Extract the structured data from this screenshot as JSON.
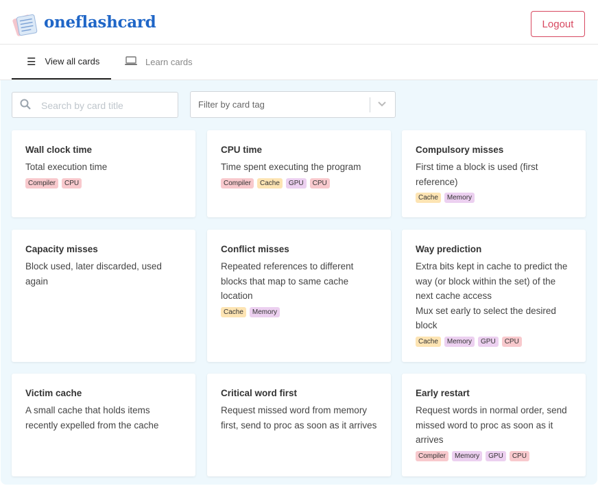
{
  "app": {
    "brand": "oneflashcard",
    "logout_label": "Logout"
  },
  "tabs": [
    {
      "label": "View all cards",
      "icon": "menu-icon",
      "active": true
    },
    {
      "label": "Learn cards",
      "icon": "laptop-icon",
      "active": false
    }
  ],
  "search": {
    "placeholder": "Search by card title",
    "value": ""
  },
  "filter": {
    "placeholder": "Filter by card tag"
  },
  "tag_colors": {
    "Compiler": "#f8c9cd",
    "CPU": "#f8c9cd",
    "Cache": "#fde4b3",
    "GPU": "#ecd0f0",
    "Memory": "#ecd0f0"
  },
  "cards": [
    {
      "title": "Wall clock time",
      "lines": [
        "Total execution time"
      ],
      "tags": [
        "Compiler",
        "CPU"
      ]
    },
    {
      "title": "CPU time",
      "lines": [
        "Time spent executing the program"
      ],
      "tags": [
        "Compiler",
        "Cache",
        "GPU",
        "CPU"
      ]
    },
    {
      "title": "Compulsory misses",
      "lines": [
        "First time a block is used (first reference)"
      ],
      "tags": [
        "Cache",
        "Memory"
      ]
    },
    {
      "title": "Capacity misses",
      "lines": [
        "Block used, later discarded, used again"
      ],
      "tags": []
    },
    {
      "title": "Conflict misses",
      "lines": [
        "Repeated references to different blocks that map to same cache location"
      ],
      "tags": [
        "Cache",
        "Memory"
      ]
    },
    {
      "title": "Way prediction",
      "lines": [
        "Extra bits kept in cache to predict the way (or block within the set) of the next cache access",
        "Mux set early to select the desired block"
      ],
      "tags": [
        "Cache",
        "Memory",
        "GPU",
        "CPU"
      ]
    },
    {
      "title": "Victim cache",
      "lines": [
        "A small cache that holds items recently expelled from the cache"
      ],
      "tags": []
    },
    {
      "title": "Critical word first",
      "lines": [
        "Request missed word from memory first, send to proc as soon as it arrives"
      ],
      "tags": []
    },
    {
      "title": "Early restart",
      "lines": [
        "Request words in normal order, send missed word to proc as soon as it arrives"
      ],
      "tags": [
        "Compiler",
        "Memory",
        "GPU",
        "CPU"
      ]
    }
  ]
}
